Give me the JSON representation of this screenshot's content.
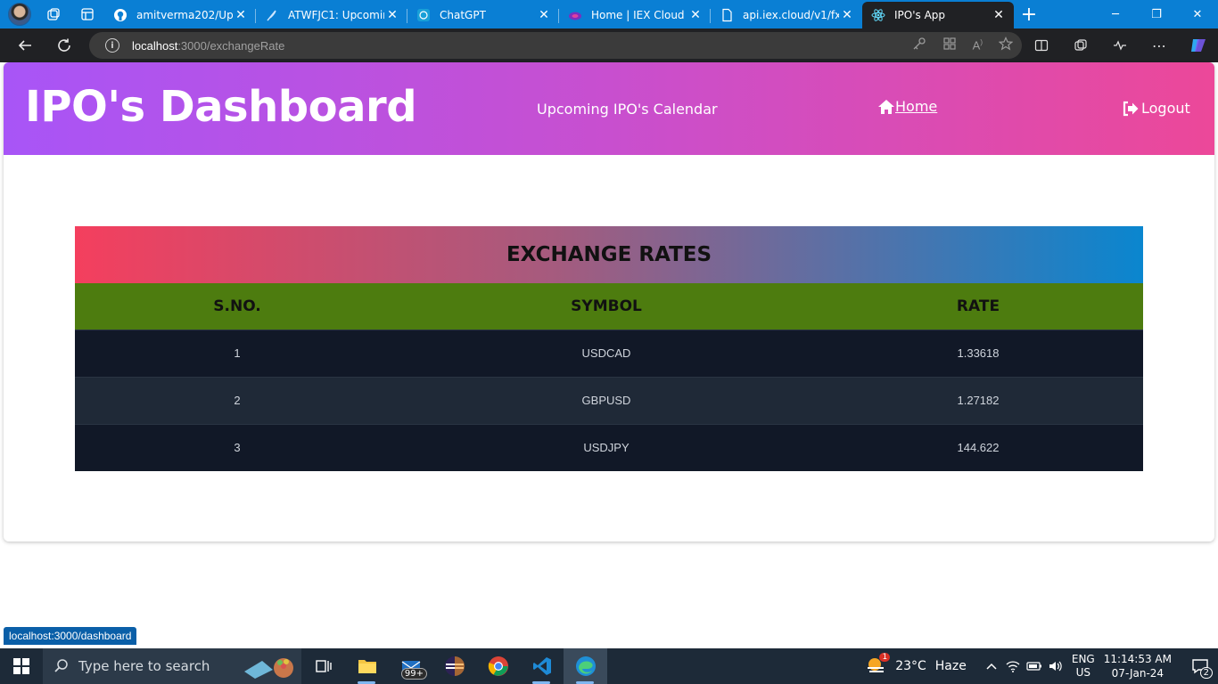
{
  "browser": {
    "tabs": [
      {
        "label": "amitverma202/Upc",
        "icon": "github-icon"
      },
      {
        "label": "ATWFJC1: Upcomin",
        "icon": "feather-icon"
      },
      {
        "label": "ChatGPT",
        "icon": "chatgpt-icon"
      },
      {
        "label": "Home | IEX Cloud",
        "icon": "iex-cloud-icon"
      },
      {
        "label": "api.iex.cloud/v1/fx/l",
        "icon": "document-icon"
      },
      {
        "label": "IPO's App",
        "icon": "react-icon",
        "active": true
      }
    ],
    "address": {
      "host": "localhost",
      "path": ":3000/exchangeRate"
    },
    "accent": "#0a7fd4"
  },
  "app": {
    "title": "IPO's Dashboard",
    "nav": {
      "calendar": "Upcoming IPO's Calendar",
      "home": "Home",
      "logout": "Logout"
    },
    "header_gradient": [
      "#a855f7",
      "#ec4899"
    ]
  },
  "exchange": {
    "title": "EXCHANGE RATES",
    "columns": [
      "S.NO.",
      "SYMBOL",
      "RATE"
    ],
    "rows": [
      {
        "sno": "1",
        "symbol": "USDCAD",
        "rate": "1.33618"
      },
      {
        "sno": "2",
        "symbol": "GBPUSD",
        "rate": "1.27182"
      },
      {
        "sno": "3",
        "symbol": "USDJPY",
        "rate": "144.622"
      }
    ],
    "header_color": "#4d7c0f"
  },
  "status_bar": {
    "url": "localhost:3000/dashboard"
  },
  "taskbar": {
    "search_placeholder": "Type here to search",
    "mail_badge": "99+",
    "weather": {
      "temp": "23°C",
      "condition": "Haze",
      "alert_count": "1"
    },
    "language": {
      "line1": "ENG",
      "line2": "US"
    },
    "clock": {
      "time": "11:14:53 AM",
      "date": "07-Jan-24"
    },
    "notification_count": "2"
  }
}
